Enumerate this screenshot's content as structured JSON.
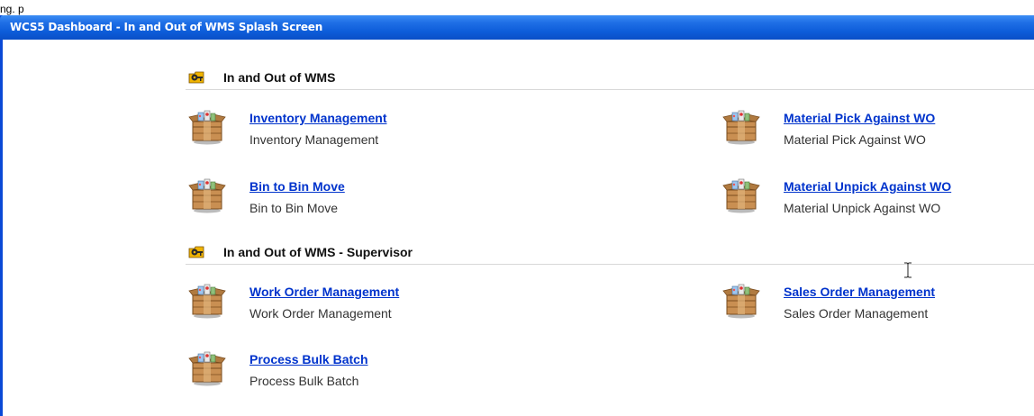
{
  "top_strip_text": "ng.                                                                                    p",
  "window": {
    "title": "WCS5 Dashboard - In and Out of WMS Splash Screen"
  },
  "sections": [
    {
      "title": "In and Out of WMS",
      "icon": "key-folder-icon",
      "items": [
        {
          "link": "Inventory Management",
          "desc": "Inventory Management",
          "icon": "package-box-icon"
        },
        {
          "link": "Material Pick Against WO",
          "desc": "Material Pick Against WO",
          "icon": "package-box-icon"
        },
        {
          "link": "Bin to Bin Move",
          "desc": "Bin to Bin Move",
          "icon": "package-box-icon"
        },
        {
          "link": "Material Unpick Against WO",
          "desc": "Material Unpick Against WO",
          "icon": "package-box-icon"
        }
      ]
    },
    {
      "title": "In and Out of WMS - Supervisor",
      "icon": "key-folder-icon",
      "items": [
        {
          "link": "Work Order Management",
          "desc": "Work Order Management",
          "icon": "package-box-icon"
        },
        {
          "link": "Sales Order Management",
          "desc": "Sales Order Management",
          "icon": "package-box-icon"
        },
        {
          "link": "Process Bulk Batch",
          "desc": "Process Bulk Batch",
          "icon": "package-box-icon"
        }
      ]
    }
  ],
  "colors": {
    "titlebar": "#0c5bd8",
    "link": "#0033cc"
  }
}
